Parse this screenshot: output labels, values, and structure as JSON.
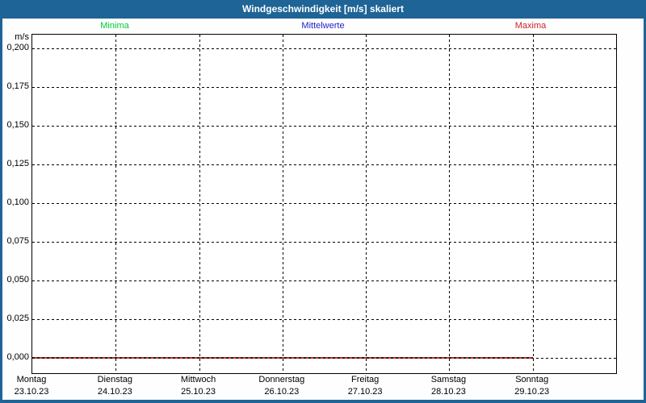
{
  "window": {
    "title": "Windgeschwindigkeit [m/s] skaliert"
  },
  "colors": {
    "frame_blue": "#1e6496",
    "content_background": "#fdfefd",
    "plot_background": "#ffffff",
    "grid_black": "#000000",
    "minima_green": "#00c832",
    "mittelwerte_blue": "#2222cc",
    "maxima_red": "#cc2233",
    "zero_line_red": "#d42a2a"
  },
  "chart_data": {
    "type": "line",
    "title": "Windgeschwindigkeit [m/s] skaliert",
    "ylabel": "m/s",
    "xlabel": "",
    "y_ticks": [
      "0,200",
      "0,175",
      "0,150",
      "0,125",
      "0,100",
      "0,075",
      "0,050",
      "0,025",
      "0,000"
    ],
    "ylim": [
      0,
      0.2
    ],
    "grid": "dashed horizontal and vertical gridlines",
    "legend_position": "top",
    "categories": [
      "Montag 23.10.23",
      "Dienstag 24.10.23",
      "Mittwoch 25.10.23",
      "Donnerstag 26.10.23",
      "Freitag 27.10.23",
      "Samstag 28.10.23",
      "Sonntag 29.10.23"
    ],
    "x_axis": {
      "days": [
        {
          "day": "Montag",
          "date": "23.10.23"
        },
        {
          "day": "Dienstag",
          "date": "24.10.23"
        },
        {
          "day": "Mittwoch",
          "date": "25.10.23"
        },
        {
          "day": "Donnerstag",
          "date": "26.10.23"
        },
        {
          "day": "Freitag",
          "date": "27.10.23"
        },
        {
          "day": "Samstag",
          "date": "28.10.23"
        },
        {
          "day": "Sonntag",
          "date": "29.10.23"
        }
      ]
    },
    "series": [
      {
        "name": "Minima",
        "color": "#00c832",
        "values": [
          0,
          0,
          0,
          0,
          0,
          0,
          0
        ]
      },
      {
        "name": "Mittelwerte",
        "color": "#2222cc",
        "values": [
          0,
          0,
          0,
          0,
          0,
          0,
          0
        ]
      },
      {
        "name": "Maxima",
        "color": "#cc2233",
        "values": [
          0,
          0,
          0,
          0,
          0,
          0,
          0
        ]
      }
    ],
    "annotation": "All three series are flat at 0,000 m/s; the visible red zero line runs from Montag 23.10.23 to Sonntag 29.10.23 00:00"
  }
}
